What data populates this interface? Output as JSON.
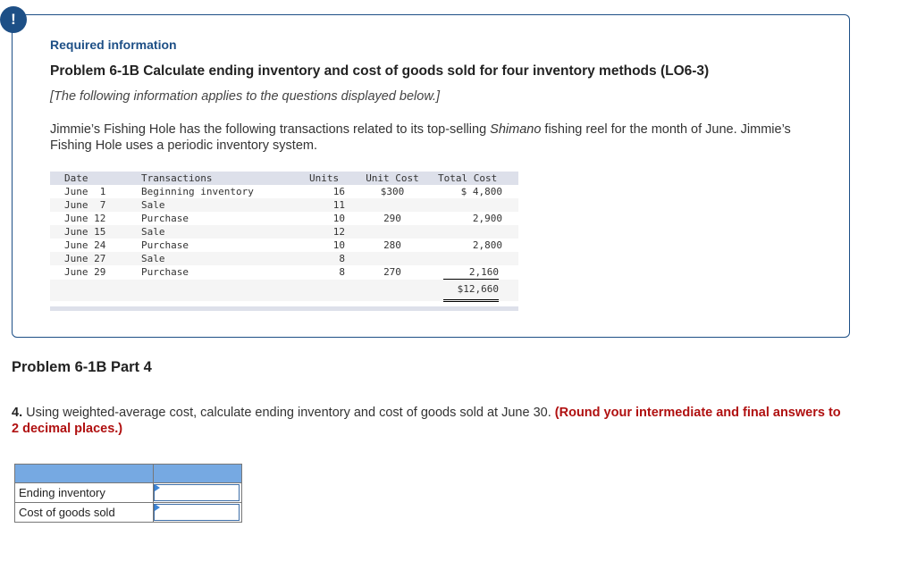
{
  "alert": {
    "icon": "!"
  },
  "info": {
    "required_label": "Required information",
    "problem_title": "Problem 6-1B Calculate ending inventory and cost of goods sold for four inventory methods (LO6-3)",
    "applies_note": "[The following information applies to the questions displayed below.]",
    "intro_part1": "Jimmie’s Fishing Hole has the following transactions related to its top-selling ",
    "intro_italic": "Shimano",
    "intro_part2": " fishing reel for the month of June. Jimmie’s Fishing Hole uses a periodic inventory system."
  },
  "transactions": {
    "headers": {
      "date": "Date",
      "transaction": "Transactions",
      "units": "Units",
      "unit_cost": "Unit Cost",
      "total_cost": "Total Cost"
    },
    "rows": [
      {
        "date": "June  1",
        "transaction": "Beginning inventory",
        "units": "16",
        "unit_cost": "$300",
        "total_cost": "$ 4,800"
      },
      {
        "date": "June  7",
        "transaction": "Sale",
        "units": "11",
        "unit_cost": "",
        "total_cost": ""
      },
      {
        "date": "June 12",
        "transaction": "Purchase",
        "units": "10",
        "unit_cost": "290",
        "total_cost": "2,900"
      },
      {
        "date": "June 15",
        "transaction": "Sale",
        "units": "12",
        "unit_cost": "",
        "total_cost": ""
      },
      {
        "date": "June 24",
        "transaction": "Purchase",
        "units": "10",
        "unit_cost": "280",
        "total_cost": "2,800"
      },
      {
        "date": "June 27",
        "transaction": "Sale",
        "units": "8",
        "unit_cost": "",
        "total_cost": ""
      },
      {
        "date": "June 29",
        "transaction": "Purchase",
        "units": "8",
        "unit_cost": "270",
        "total_cost": "2,160"
      }
    ],
    "total": "$12,660"
  },
  "part": {
    "title": "Problem 6-1B Part 4",
    "question_number": "4.",
    "question_text": " Using weighted-average cost, calculate ending inventory and cost of goods sold at June 30. ",
    "instruction": "(Round your intermediate and final answers to 2 decimal places.)"
  },
  "answer_table": {
    "rows": [
      {
        "label": "Ending inventory",
        "value": ""
      },
      {
        "label": "Cost of goods sold",
        "value": ""
      }
    ]
  }
}
